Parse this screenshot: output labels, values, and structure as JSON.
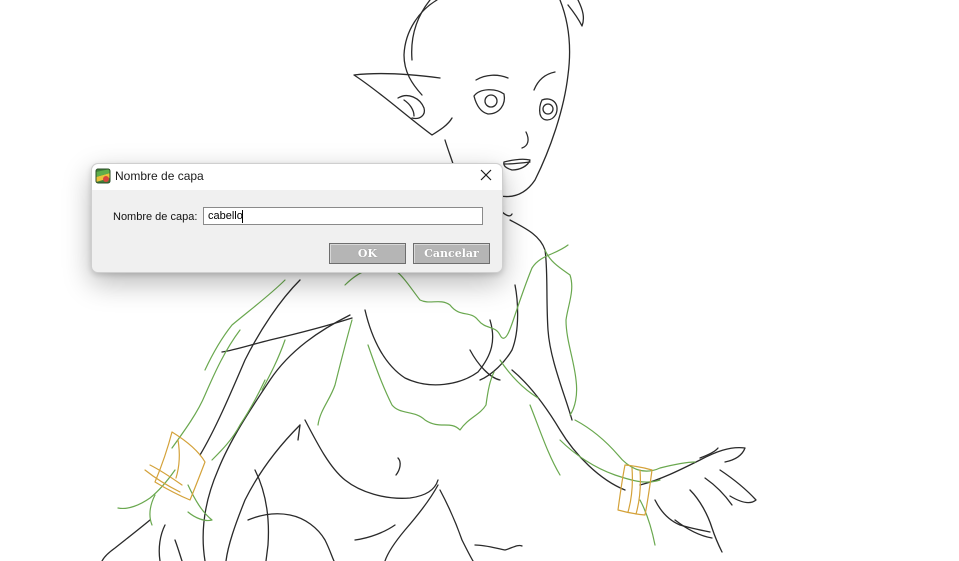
{
  "dialog": {
    "title": "Nombre de capa",
    "app_icon": "paint-app-icon",
    "close_icon": "close-icon",
    "field_label": "Nombre de capa:",
    "field_value": "cabello",
    "ok_label": "OK",
    "cancel_label": "Cancelar"
  },
  "canvas": {
    "description_icon": "line-art-drawing",
    "colors": {
      "ink": "#2a2a2a",
      "green_layer": "#6aa84f",
      "gold_layer": "#d4a23a"
    }
  }
}
